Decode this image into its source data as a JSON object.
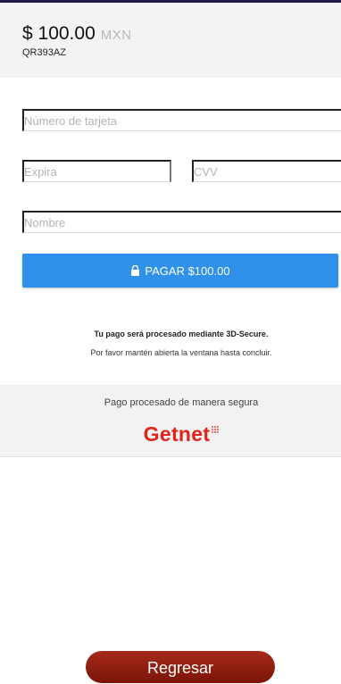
{
  "header": {
    "amount": "$ 100.00",
    "currency": "MXN",
    "order_id": "QR393AZ"
  },
  "form": {
    "card_number_placeholder": "Número de tarjeta",
    "expiry_placeholder": "Expira",
    "cvv_placeholder": "CVV",
    "name_placeholder": "Nombre"
  },
  "pay_button": {
    "label": "PAGAR $100.00",
    "icon": "lock-icon",
    "color": "#2f91ea"
  },
  "notice": {
    "title": "Tu pago será procesado mediante 3D-Secure.",
    "subtitle": "Por favor mantén abierta la ventana hasta concluir."
  },
  "secure": {
    "text": "Pago procesado de manera segura",
    "logo_text": "Getnet",
    "logo_color": "#e0231b"
  },
  "back_button": {
    "label": "Regresar"
  }
}
